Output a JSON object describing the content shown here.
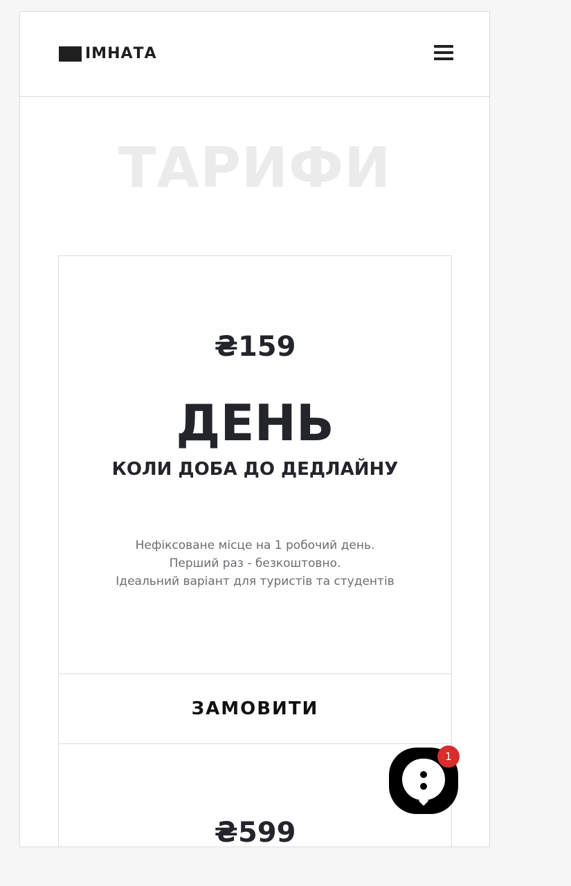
{
  "header": {
    "logo_text": "ІМНАТА",
    "menu_icon": "hamburger-icon"
  },
  "section": {
    "title": "ТАРИФИ"
  },
  "plan": {
    "price": "₴159",
    "name": "ДЕНЬ",
    "subtitle": "КОЛИ ДОБА ДО ДЕДЛАЙНУ",
    "description": [
      "Нефіксоване місце на 1 робочий день.",
      "Перший раз - безкоштовно.",
      "Ідеальний варіант для туристів та студентів"
    ],
    "order_label": "ЗАМОВИТИ"
  },
  "next_plan": {
    "price": "₴599"
  },
  "chat_widget": {
    "icon": "chat-icon",
    "badge_count": "1",
    "badge_color": "#d72d2d"
  }
}
